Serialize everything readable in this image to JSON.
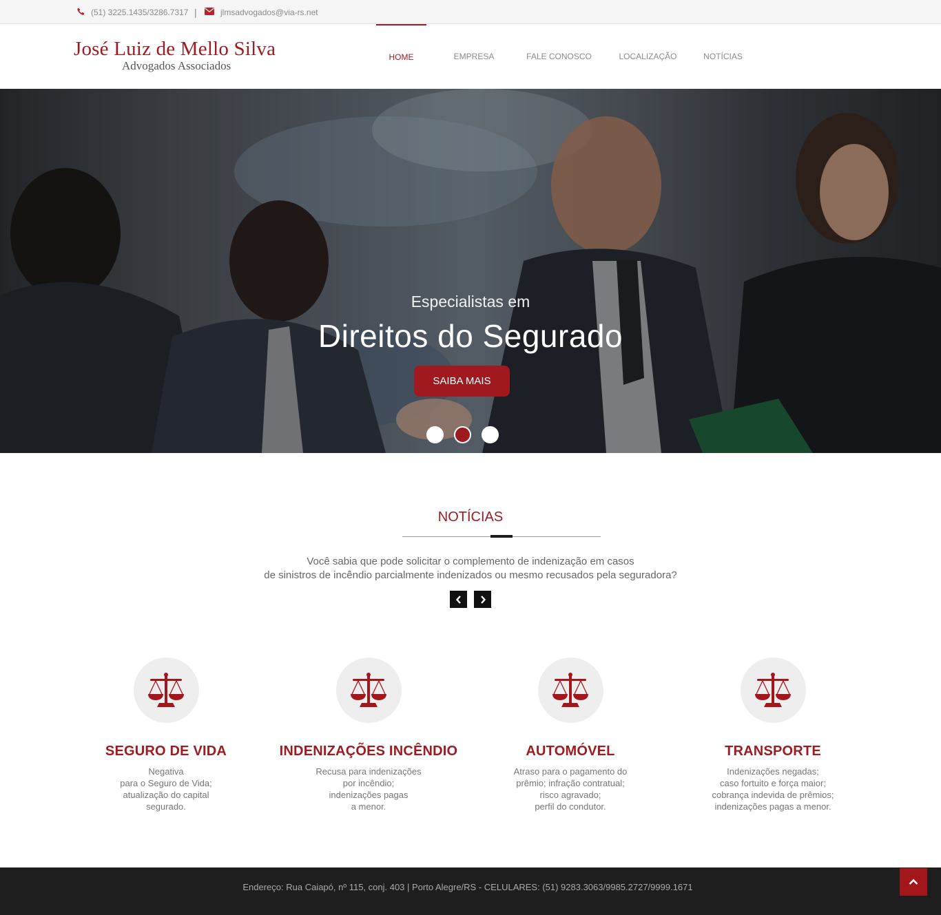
{
  "topbar": {
    "phone_icon": "phone-icon",
    "phone": "(51) 3225.1435/3286.7317",
    "separator": "|",
    "email_icon": "envelope-icon",
    "email": "jlmsadvogados@via-rs.net"
  },
  "logo": {
    "name": "José Luiz de Mello Silva",
    "subtitle": "Advogados Associados"
  },
  "nav": {
    "items": [
      {
        "label": "HOME",
        "active": true
      },
      {
        "label": "EMPRESA",
        "active": false
      },
      {
        "label": "FALE CONOSCO",
        "active": false
      },
      {
        "label": "LOCALIZAÇÃO",
        "active": false
      },
      {
        "label": "NOTÍCIAS",
        "active": false
      }
    ]
  },
  "hero": {
    "kicker": "Especialistas em",
    "headline": "Direitos do Segurado",
    "cta": "SAIBA MAIS",
    "slides": 3,
    "active_slide": 2
  },
  "news": {
    "title": "NOTÍCIAS",
    "line1": "Você sabia que pode solicitar o complemento de indenização em casos",
    "line2": "de sinistros de incêndio parcialmente indenizados ou mesmo recusados pela seguradora?",
    "prev_icon": "chevron-left-icon",
    "next_icon": "chevron-right-icon"
  },
  "services": [
    {
      "icon": "scales-icon",
      "title": "SEGURO DE VIDA",
      "lines": [
        "Negativa",
        "para o Seguro de Vida;",
        "atualização do capital",
        "segurado."
      ]
    },
    {
      "icon": "scales-icon",
      "title": "INDENIZAÇÕES INCÊNDIO",
      "lines": [
        "Recusa para indenizações",
        "por incêndio;",
        "indenizações pagas",
        "a menor."
      ]
    },
    {
      "icon": "scales-icon",
      "title": "AUTOMÓVEL",
      "lines": [
        "Atraso para o pagamento do",
        "prêmio; infração contratual;",
        "risco agravado;",
        "perfil do condutor."
      ]
    },
    {
      "icon": "scales-icon",
      "title": "TRANSPORTE",
      "lines": [
        "Indenizações negadas;",
        "caso fortuito e força maior;",
        "cobrança indevida de prêmios;",
        "indenizações pagas a menor."
      ]
    }
  ],
  "footer": {
    "address": "Endereço: Rua Caiapó, nº 115, conj. 403 | Porto Alegre/RS - CELULARES: (51) 9283.3063/9985.2727/9999.1671",
    "to_top_icon": "chevron-up-icon"
  },
  "colors": {
    "brand_red": "#9e1b21",
    "footer_bg": "#1e1e1e",
    "topbar_bg": "#f6f5f5"
  }
}
